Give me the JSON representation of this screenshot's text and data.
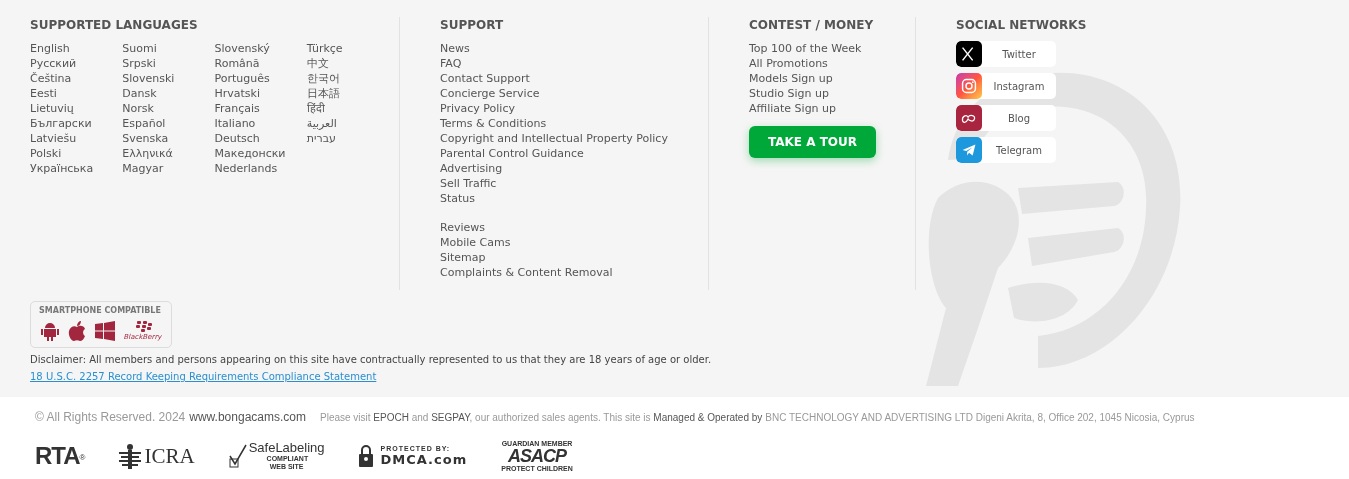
{
  "languages": {
    "title": "SUPPORTED LANGUAGES",
    "columns": [
      [
        "English",
        "Русский",
        "Čeština",
        "Eesti",
        "Lietuvių",
        "Български",
        "Latviešu",
        "Polski",
        "Українська"
      ],
      [
        "Suomi",
        "Srpski",
        "Slovenski",
        "Dansk",
        "Norsk",
        "Español",
        "Svenska",
        "Ελληνικά",
        "Magyar"
      ],
      [
        "Slovenský",
        "Română",
        "Português",
        "Hrvatski",
        "Français",
        "Italiano",
        "Deutsch",
        "Македонски",
        "Nederlands"
      ],
      [
        "Türkçe",
        "中文",
        "한국어",
        "日本語",
        "हिंदी",
        "العربية",
        "עברית"
      ]
    ]
  },
  "support": {
    "title": "SUPPORT",
    "groups": [
      [
        "News",
        "FAQ",
        "Contact Support",
        "Concierge Service",
        "Privacy Policy",
        "Terms & Conditions",
        "Copyright and Intellectual Property Policy",
        "Parental Control Guidance",
        "Advertising",
        "Sell Traffic",
        "Status"
      ],
      [
        "Reviews",
        "Mobile Cams",
        "Sitemap",
        "Complaints & Content Removal"
      ]
    ]
  },
  "contest": {
    "title": "CONTEST / MONEY",
    "links": [
      "Top 100 of the Week",
      "All Promotions",
      "Models Sign up",
      "Studio Sign up",
      "Affiliate Sign up"
    ],
    "tour_button": "TAKE A TOUR"
  },
  "social": {
    "title": "SOCIAL NETWORKS",
    "items": [
      {
        "label": "Twitter",
        "kind": "x"
      },
      {
        "label": "Instagram",
        "kind": "instagram"
      },
      {
        "label": "Blog",
        "kind": "blog"
      },
      {
        "label": "Telegram",
        "kind": "telegram"
      }
    ]
  },
  "smartphone": {
    "title": "SMARTPHONE COMPATIBLE",
    "platforms": [
      {
        "kind": "android"
      },
      {
        "kind": "apple"
      },
      {
        "kind": "windows"
      },
      {
        "kind": "blackberry",
        "label": "BlackBerry"
      }
    ]
  },
  "disclaimer": "Disclaimer: All members and persons appearing on this site have contractually represented to us that they are 18 years of age or older.",
  "compliance_link": "18 U.S.C. 2257 Record Keeping Requirements Compliance Statement",
  "bottom": {
    "copyright": "© All Rights Reserved. 2024",
    "site": "www.bongacams.com",
    "notice": "Please visit **EPOCH** and **SEGPAY**, our authorized sales agents. This site is **Managed & Operated by**",
    "company": "BNC TECHNOLOGY AND ADVERTISING LTD Digeni Akrita, 8, Office 202, 1045 Nicosia, Cyprus"
  },
  "badges": [
    {
      "kind": "rta",
      "text": "RTA",
      "mark": "®"
    },
    {
      "kind": "icra",
      "text": "ICRA"
    },
    {
      "kind": "safelabeling",
      "text": "SafeLabeling",
      "subtitle": "COMPLIANT WEB SITE"
    },
    {
      "kind": "dmca",
      "caption": "PROTECTED BY:",
      "text": "DMCA.com"
    },
    {
      "kind": "asacp",
      "caption": "GUARDIAN MEMBER",
      "text": "ASACP",
      "subtitle": "PROTECT CHILDREN"
    }
  ]
}
